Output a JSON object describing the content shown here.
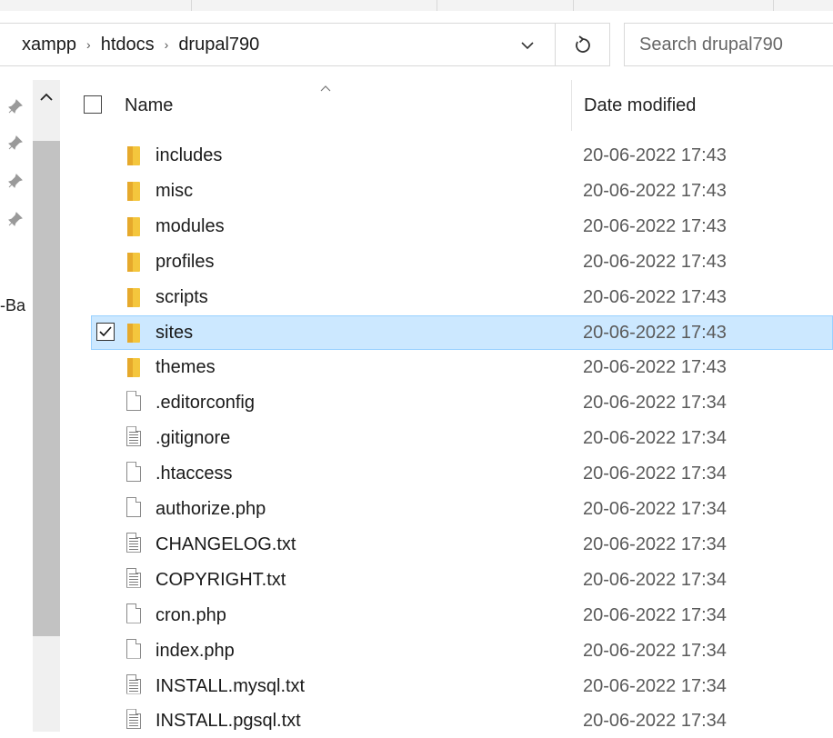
{
  "address_bar": {
    "breadcrumbs": [
      "xampp",
      "htdocs",
      "drupal790"
    ],
    "separator": "›",
    "search_placeholder": "Search drupal790"
  },
  "nav": {
    "partial_label": "-Ba"
  },
  "columns": {
    "name": "Name",
    "date_modified": "Date modified"
  },
  "files": [
    {
      "name": "includes",
      "date": "20-06-2022 17:43",
      "type": "folder",
      "selected": false
    },
    {
      "name": "misc",
      "date": "20-06-2022 17:43",
      "type": "folder",
      "selected": false
    },
    {
      "name": "modules",
      "date": "20-06-2022 17:43",
      "type": "folder",
      "selected": false
    },
    {
      "name": "profiles",
      "date": "20-06-2022 17:43",
      "type": "folder",
      "selected": false
    },
    {
      "name": "scripts",
      "date": "20-06-2022 17:43",
      "type": "folder",
      "selected": false
    },
    {
      "name": "sites",
      "date": "20-06-2022 17:43",
      "type": "folder",
      "selected": true
    },
    {
      "name": "themes",
      "date": "20-06-2022 17:43",
      "type": "folder",
      "selected": false
    },
    {
      "name": ".editorconfig",
      "date": "20-06-2022 17:34",
      "type": "file",
      "selected": false
    },
    {
      "name": ".gitignore",
      "date": "20-06-2022 17:34",
      "type": "text",
      "selected": false
    },
    {
      "name": ".htaccess",
      "date": "20-06-2022 17:34",
      "type": "file",
      "selected": false
    },
    {
      "name": "authorize.php",
      "date": "20-06-2022 17:34",
      "type": "file",
      "selected": false
    },
    {
      "name": "CHANGELOG.txt",
      "date": "20-06-2022 17:34",
      "type": "text",
      "selected": false
    },
    {
      "name": "COPYRIGHT.txt",
      "date": "20-06-2022 17:34",
      "type": "text",
      "selected": false
    },
    {
      "name": "cron.php",
      "date": "20-06-2022 17:34",
      "type": "file",
      "selected": false
    },
    {
      "name": "index.php",
      "date": "20-06-2022 17:34",
      "type": "file",
      "selected": false
    },
    {
      "name": "INSTALL.mysql.txt",
      "date": "20-06-2022 17:34",
      "type": "text",
      "selected": false
    },
    {
      "name": "INSTALL.pgsql.txt",
      "date": "20-06-2022 17:34",
      "type": "text",
      "selected": false
    }
  ],
  "icons": {
    "refresh": "refresh-icon",
    "dropdown": "chevron-down-icon",
    "pin": "pin-icon",
    "folder": "folder-icon",
    "file": "file-icon",
    "text_file": "text-file-icon",
    "checkmark": "checkmark-icon"
  },
  "colors": {
    "selection_bg": "#cce8ff",
    "selection_border": "#99d1ff",
    "folder": "#f4c63d"
  }
}
